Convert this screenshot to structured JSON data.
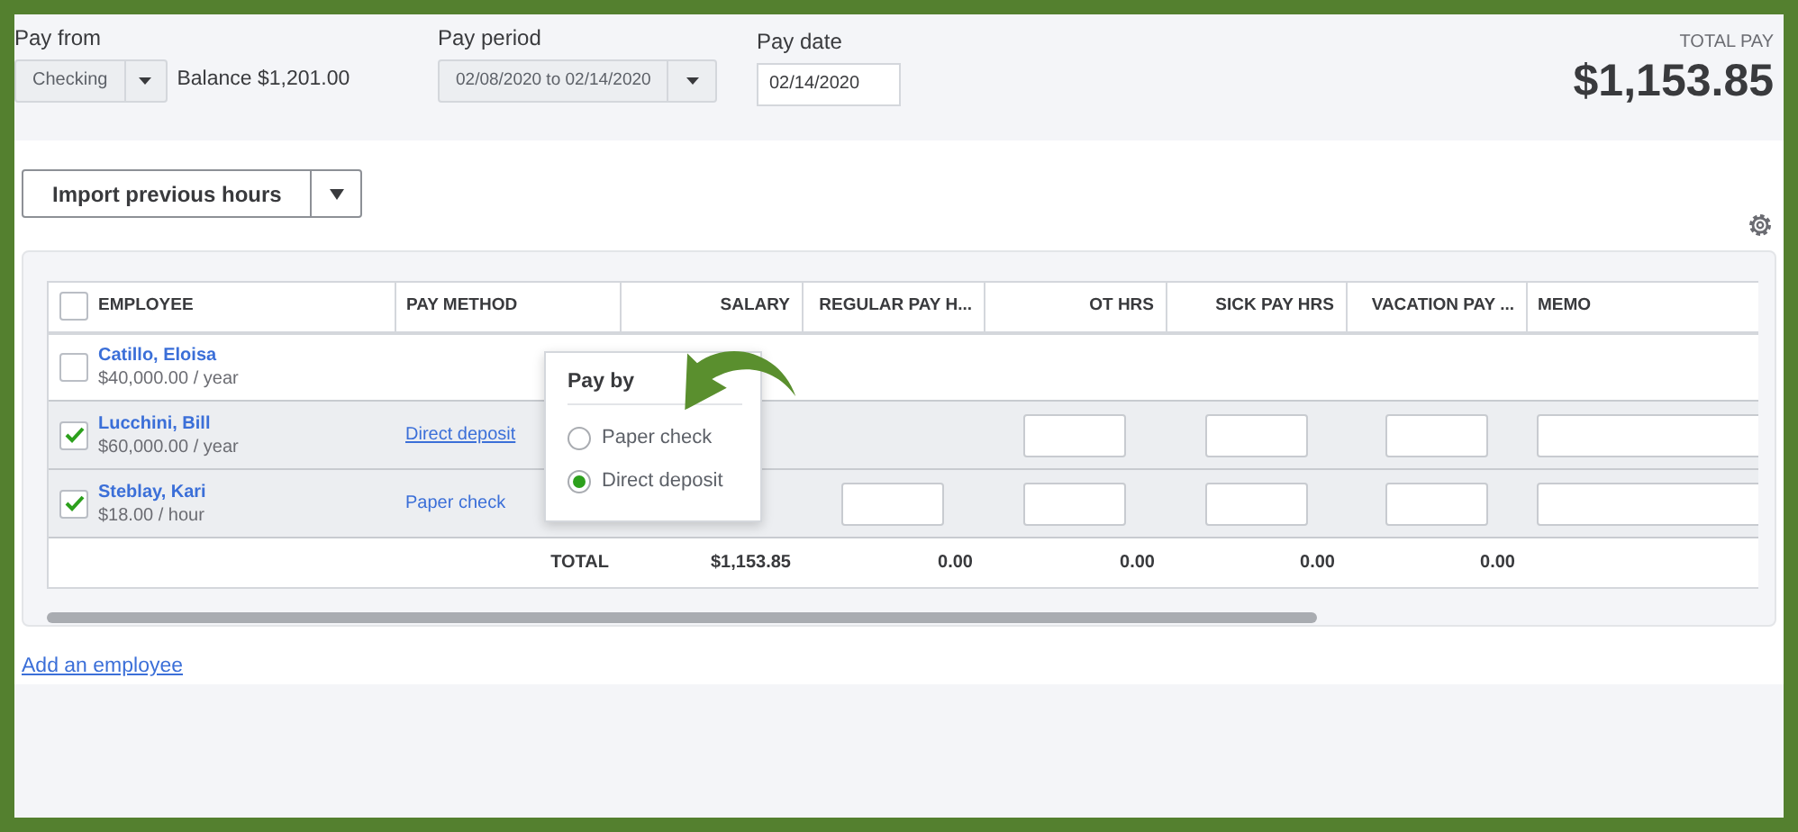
{
  "header": {
    "pay_from": {
      "label": "Pay from",
      "account": "Checking",
      "balance": "Balance $1,201.00"
    },
    "pay_period": {
      "label": "Pay period",
      "value": "02/08/2020 to 02/14/2020"
    },
    "pay_date": {
      "label": "Pay date",
      "value": "02/14/2020"
    },
    "total_pay": {
      "label": "TOTAL PAY",
      "amount": "$1,153.85"
    }
  },
  "import_button": {
    "label": "Import previous hours"
  },
  "table": {
    "all_selected": false,
    "columns": [
      "EMPLOYEE",
      "PAY METHOD",
      "SALARY",
      "REGULAR PAY H...",
      "OT HRS",
      "SICK PAY HRS",
      "VACATION PAY ...",
      "MEMO"
    ],
    "rows": [
      {
        "name": "Catillo, Eloisa",
        "rate": "$40,000.00 / year",
        "selected": false,
        "input_fields": [
          false,
          false,
          false,
          false,
          false
        ]
      },
      {
        "name": "Lucchini, Bill",
        "rate": "$60,000.00 / year",
        "selected": true,
        "pay_method": "Direct deposit",
        "pay_method_open": true,
        "input_fields": [
          false,
          true,
          true,
          true,
          true
        ]
      },
      {
        "name": "Steblay, Kari",
        "rate": "$18.00 / hour",
        "selected": true,
        "pay_method": "Paper check",
        "pay_method_open": false,
        "input_fields": [
          true,
          true,
          true,
          true,
          true
        ]
      }
    ],
    "totals": {
      "label": "TOTAL",
      "values": [
        "$1,153.85",
        "0.00",
        "0.00",
        "0.00",
        "0.00"
      ]
    }
  },
  "popover": {
    "title": "Pay by",
    "options": [
      {
        "label": "Paper check",
        "selected": false
      },
      {
        "label": "Direct deposit",
        "selected": true
      }
    ]
  },
  "add_employee": "Add an employee"
}
